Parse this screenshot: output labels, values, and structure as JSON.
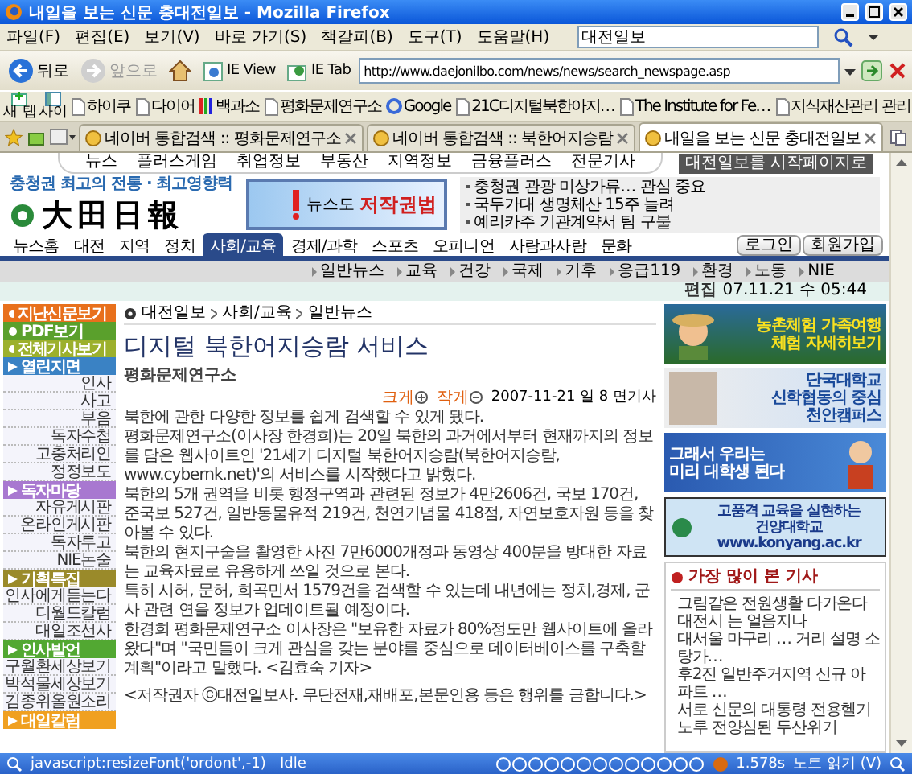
{
  "window": {
    "title": "내일을 보는 신문 충대전일보 - Mozilla Firefox"
  },
  "menu": [
    "파일(F)",
    "편집(E)",
    "보기(V)",
    "바로 가기(S)",
    "책갈피(B)",
    "도구(T)",
    "도움말(H)"
  ],
  "search": {
    "value": "대전일보"
  },
  "toolbar": {
    "buttons": [
      {
        "label": "뒤로",
        "kind": "back",
        "disabled": false
      },
      {
        "label": "앞으로",
        "kind": "forward",
        "disabled": true
      },
      {
        "kind": "home"
      },
      {
        "label": "IE View",
        "kind": "ieview"
      },
      {
        "label": "IE Tab",
        "kind": "ietab"
      }
    ],
    "url": "http://www.daejonilbo.com/news/news/search_newspage.asp"
  },
  "bookmarks": {
    "buttons": [
      {
        "label": "새 탭",
        "kind": "newtab"
      },
      {
        "label": "사이",
        "kind": "sidebar"
      }
    ],
    "items": [
      {
        "label": "하이쿠",
        "kind": "page"
      },
      {
        "label": "다이어",
        "kind": "page"
      },
      {
        "label": "백과소",
        "kind": "colorbars"
      },
      {
        "label": "평화문제연구소",
        "kind": "page"
      },
      {
        "label": "Google",
        "kind": "google"
      },
      {
        "label": "21C디지털북한아지…",
        "kind": "page"
      },
      {
        "label": "The Institute for Fe…",
        "kind": "page"
      },
      {
        "label": "지식재산관리 관리",
        "kind": "page"
      }
    ]
  },
  "tabs": [
    {
      "label": "네이버 통합검색 :: 평화문제연구소",
      "selected": false
    },
    {
      "label": "네이버 통합검색 :: 북한어지승람",
      "selected": false
    },
    {
      "label": "내일을 보는 신문 충대전일보",
      "selected": true
    }
  ],
  "site": {
    "top_links": [
      "뉴스",
      "플러스게임",
      "취업정보",
      "부동산",
      "지역정보",
      "금융플러스",
      "전문기사"
    ],
    "start_page_badge": "대전일보를 시작페이지로",
    "slogan": "충청권 최고의 전통 · 최고영향력",
    "logo": "大田日報",
    "banner": {
      "small": "뉴스도",
      "big": "저작권법"
    },
    "headlines": [
      "충청권 관광 미상가류… 관심 중요",
      "국두가대 생명체산 15주 늘려",
      "예리카주 기관계약서 팀 구불"
    ],
    "sections": [
      {
        "label": "뉴스홈",
        "selected": false
      },
      {
        "label": "대전",
        "selected": false
      },
      {
        "label": "지역",
        "selected": false
      },
      {
        "label": "정치",
        "selected": false
      },
      {
        "label": "사회/교육",
        "selected": true
      },
      {
        "label": "경제/과학",
        "selected": false
      },
      {
        "label": "스포츠",
        "selected": false
      },
      {
        "label": "오피니언",
        "selected": false
      },
      {
        "label": "사람과사람",
        "selected": false
      },
      {
        "label": "문화",
        "selected": false
      }
    ],
    "account_buttons": [
      "로그인",
      "회원가입"
    ],
    "subsections": [
      "일반뉴스",
      "교육",
      "건강",
      "국제",
      "기후",
      "응급119",
      "환경",
      "노동",
      "NIE"
    ],
    "edition": {
      "label": "편집",
      "date": "07.11.21 수 05:44"
    },
    "sidebar": [
      {
        "kind": "button",
        "label": "지난신문보기",
        "color": "#e8701c"
      },
      {
        "kind": "button",
        "label": "PDF보기",
        "color": "#5aa02c"
      },
      {
        "kind": "button",
        "label": "전체기사보기",
        "color": "#9cb02c"
      },
      {
        "kind": "heading",
        "label": "열린지면",
        "color": "#3a82c4"
      },
      {
        "kind": "link",
        "label": "인사"
      },
      {
        "kind": "link",
        "label": "사고"
      },
      {
        "kind": "link",
        "label": "부음"
      },
      {
        "kind": "link",
        "label": "독자수첩"
      },
      {
        "kind": "link",
        "label": "고충처리인"
      },
      {
        "kind": "link",
        "label": "정정보도"
      },
      {
        "kind": "heading",
        "label": "독자마당",
        "color": "#a878d0"
      },
      {
        "kind": "link",
        "label": "자유게시판"
      },
      {
        "kind": "link",
        "label": "온라인게시판"
      },
      {
        "kind": "link",
        "label": "독자투고"
      },
      {
        "kind": "link",
        "label": "NIE논술"
      },
      {
        "kind": "heading",
        "label": "기획특집",
        "color": "#9a8a2a"
      },
      {
        "kind": "link",
        "label": "인사에게듣는다"
      },
      {
        "kind": "link",
        "label": "디월드칼럼"
      },
      {
        "kind": "link",
        "label": "대일조선사"
      },
      {
        "kind": "heading",
        "label": "인사발언",
        "color": "#52a832"
      },
      {
        "kind": "link",
        "label": "구월환세상보기"
      },
      {
        "kind": "link",
        "label": "박석물세상보기"
      },
      {
        "kind": "link",
        "label": "김종위올원소리"
      },
      {
        "kind": "heading",
        "label": "대일칼럼",
        "color": "#f0a020"
      }
    ],
    "article": {
      "breadcrumb": [
        "대전일보",
        "사회/교육",
        "일반뉴스"
      ],
      "title": "디지털 북한어지승람 서비스",
      "source": "평화문제연구소",
      "font_controls": [
        {
          "label": "크게",
          "kind": "bigger"
        },
        {
          "label": "작게",
          "kind": "smaller"
        }
      ],
      "date": "2007-11-21 일 8 면기사",
      "paragraphs": [
        "북한에 관한 다양한 정보를 쉽게 검색할 수 있게 됐다.",
        "평화문제연구소(이사장 한경희)는 20일 북한의 과거에서부터 현재까지의 정보를 담은 웹사이트인 '21세기 디지털 북한어지승람(북한어지승람, www.cybernk.net)'의 서비스를 시작했다고 밝혔다.",
        "북한의 5개 권역을 비롯 행정구역과 관련된 정보가 4만2606건, 국보 170건, 준국보 527건, 일반동물유적 219건, 천연기념물 418점, 자연보호자원 등을 찾아볼 수 있다.",
        "북한의 현지구술을 촬영한 사진 7만6000개정과 동영상 400분을 방대한 자료는 교육자료로 유용하게 쓰일 것으로 본다.",
        "특히 시허, 문허, 희곡민서 1579건을 검색할 수 있는데 내년에는 정치,경제, 군사 관련 연을 정보가 업데이트될 예정이다.",
        "한경희 평화문제연구소 이사장은 \"보유한 자료가 80%정도만 웹사이트에 올라왔다\"며 \"국민들이 크게 관심을 갖는 분야를 중심으로 데이터베이스를 구축할 계획\"이라고 말했다. <김효숙 기자>"
      ],
      "copyright": "<저작권자 ⓒ대전일보사. 무단전재,재배포,본문인용 등은 행위를 금합니다.>"
    },
    "ads": [
      {
        "kind": "farm",
        "lines": [
          "농촌체험 가족여행",
          "체험 자세히보기"
        ]
      },
      {
        "kind": "university",
        "lines": [
          "단국대학교",
          "신학협동의 중심",
          "천안캠퍼스"
        ]
      },
      {
        "kind": "student",
        "lines": [
          "그래서 우리는",
          "미리 대학생 된다"
        ]
      },
      {
        "kind": "college",
        "lines": [
          "고품격 교육을 실현하는",
          "건양대학교",
          "www.konyang.ac.kr"
        ]
      }
    ],
    "most_viewed": {
      "title": "가장 많이 본 기사",
      "items": [
        "그림같은 전원생활 다가온다",
        "대전시 는 얼음지나",
        "대서울 마구리 … 거리 설명 소탕가…",
        "후2진 일반주거지역 신규 아파트 …",
        "서로 신문의 대통령 전용헬기",
        "노루 전양심된 두산위기"
      ]
    }
  },
  "status_bar": {
    "text": "javascript:resizeFont('ordont',-1)",
    "state": "Idle",
    "time": "1.578s",
    "notes": "노트 읽기 (V)"
  }
}
